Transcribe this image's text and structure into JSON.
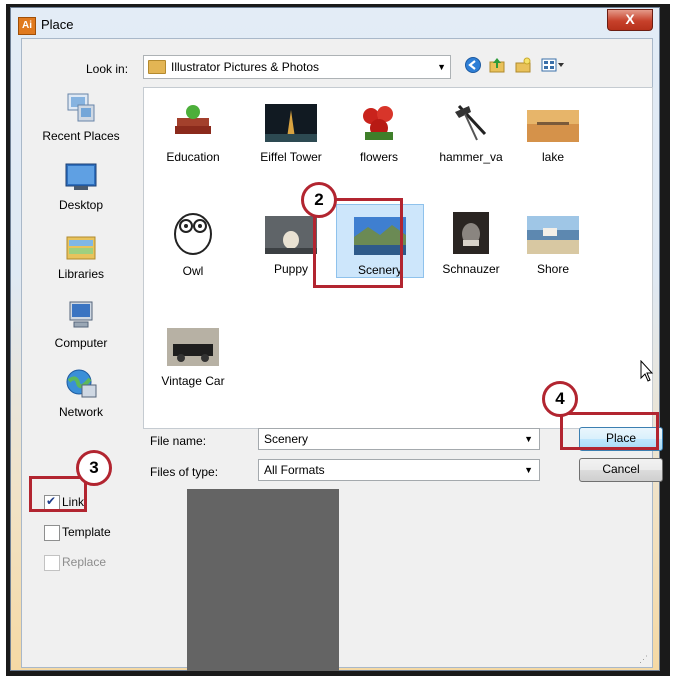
{
  "window": {
    "title": "Place",
    "app_badge": "Ai",
    "close_glyph": "X"
  },
  "toolbar": {
    "look_in_label": "Look in:",
    "look_in_value": "Illustrator Pictures & Photos",
    "icons": [
      "back-icon",
      "up-folder-icon",
      "new-folder-icon",
      "view-menu-icon"
    ]
  },
  "places": [
    {
      "label": "Recent Places",
      "icon": "recent-places-icon"
    },
    {
      "label": "Desktop",
      "icon": "desktop-icon"
    },
    {
      "label": "Libraries",
      "icon": "libraries-icon"
    },
    {
      "label": "Computer",
      "icon": "computer-icon"
    },
    {
      "label": "Network",
      "icon": "network-icon"
    }
  ],
  "files": [
    {
      "label": "Education"
    },
    {
      "label": "Eiffel Tower"
    },
    {
      "label": "flowers"
    },
    {
      "label": "hammer_va"
    },
    {
      "label": "lake"
    },
    {
      "label": "Owl"
    },
    {
      "label": "Puppy"
    },
    {
      "label": "Scenery",
      "selected": true
    },
    {
      "label": "Schnauzer"
    },
    {
      "label": "Shore"
    },
    {
      "label": "Vintage Car"
    }
  ],
  "form": {
    "file_name_label": "File name:",
    "file_name_value": "Scenery",
    "file_type_label": "Files of type:",
    "file_type_value": "All Formats",
    "place_button": "Place",
    "cancel_button": "Cancel"
  },
  "options": {
    "link": {
      "label": "Link",
      "checked": true
    },
    "template": {
      "label": "Template",
      "checked": false
    },
    "replace": {
      "label": "Replace",
      "checked": false,
      "disabled": true
    }
  },
  "callouts": [
    "2",
    "3",
    "4"
  ],
  "colors": {
    "callout": "#b22530",
    "selection": "#cde6fb",
    "close": "#c7412b",
    "preview": "#646464"
  }
}
